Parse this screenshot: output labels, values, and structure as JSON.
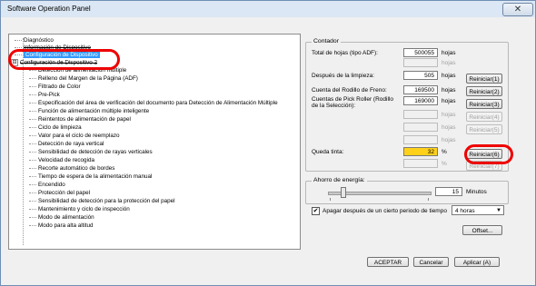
{
  "window": {
    "title": "Software Operation Panel",
    "close_glyph": "✕"
  },
  "tree": {
    "items": [
      {
        "label": "Diagnóstico"
      },
      {
        "label": "Información de Dispositivo"
      },
      {
        "label": "Configuración de Dispositivo"
      },
      {
        "label": "Configuración de Dispositivo 2",
        "expander": "⊟"
      },
      {
        "label": "Detección de alimentación múltiple"
      },
      {
        "label": "Relleno del Margen de la Página (ADF)"
      },
      {
        "label": "Filtrado de Color"
      },
      {
        "label": "Pre-Pick"
      },
      {
        "label": "Especificación del área de verificación del documento para Detección de Alimentación Múltiple"
      },
      {
        "label": "Función de alimentación múltiple inteligente"
      },
      {
        "label": "Reintentos de alimentación de papel"
      },
      {
        "label": "Ciclo de limpieza"
      },
      {
        "label": "Valor para el ciclo de reemplazo"
      },
      {
        "label": "Detección de raya vertical"
      },
      {
        "label": "Sensibilidad de detección de rayas verticales"
      },
      {
        "label": "Velocidad de recogida"
      },
      {
        "label": "Recorte automático de bordes"
      },
      {
        "label": "Tiempo de espera de la alimentación manual"
      },
      {
        "label": "Encendido"
      },
      {
        "label": "Protección del papel"
      },
      {
        "label": "Sensibilidad de detección para la protección del papel"
      },
      {
        "label": "Mantenimiento y ciclo de inspección"
      },
      {
        "label": "Modo de alimentación"
      },
      {
        "label": "Modo para alta altitud"
      }
    ]
  },
  "counter": {
    "legend": "Contador",
    "total_label": "Total de hojas (tipo ADF):",
    "total_value": "500055",
    "after_clean_label": "Después de la limpieza:",
    "after_clean_value": "505",
    "brake_label": "Cuenta del Rodillo de Freno:",
    "brake_value": "169500",
    "pick_label": "Cuentas de Pick Roller (Rodillo de la  Selección):",
    "pick_value": "169000",
    "ink_label": "Queda tinta:",
    "ink_value": "32",
    "unit_sheets": "hojas",
    "unit_percent": "%",
    "reset_buttons": [
      "Reiniciar(1)",
      "Reiniciar(2)",
      "Reiniciar(3)",
      "Reiniciar(4)",
      "Reiniciar(5)",
      "Reiniciar(6)",
      "Reiniciar(7)"
    ]
  },
  "energy": {
    "legend": "Ahorro de energía:",
    "minutes_value": "15",
    "minutes_label": "Minutos",
    "slider_level_minutes": 15,
    "checkbox_label": "Apagar después de un cierto periodo de tiempo",
    "checkbox_checked": true,
    "checkbox_mark": "✔",
    "select_value": "4 horas",
    "select_arrow": "▼",
    "offset_button": "Offset..."
  },
  "footer": {
    "accept": "ACEPTAR",
    "cancel": "Cancelar",
    "apply": "Aplicar (A)"
  }
}
